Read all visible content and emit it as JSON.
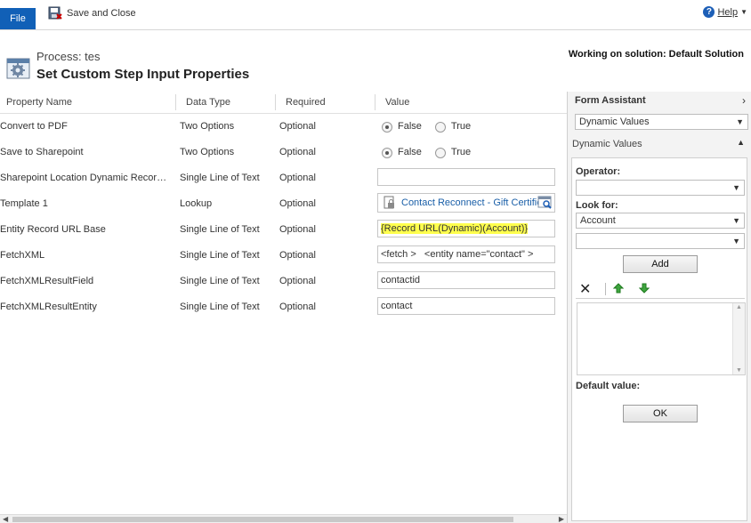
{
  "toolbar": {
    "file_label": "File",
    "save_close_label": "Save and Close",
    "help_label": "Help",
    "help_icon": "?"
  },
  "header": {
    "process": "Process: tes",
    "title": "Set Custom Step Input Properties",
    "solution": "Working on solution: Default Solution"
  },
  "grid": {
    "columns": [
      "Property Name",
      "Data Type",
      "Required",
      "Value"
    ],
    "rows": [
      {
        "name": "Convert to PDF",
        "type": "Two Options",
        "required": "Optional"
      },
      {
        "name": "Save to Sharepoint",
        "type": "Two Options",
        "required": "Optional"
      },
      {
        "name": "Sharepoint Location Dynamic Record ...",
        "type": "Single Line of Text",
        "required": "Optional",
        "value": ""
      },
      {
        "name": "Template 1",
        "type": "Lookup",
        "required": "Optional",
        "value": "Contact Reconnect - Gift Certific"
      },
      {
        "name": "Entity Record URL Base",
        "type": "Single Line of Text",
        "required": "Optional",
        "value": "{Record URL(Dynamic)(Account)}"
      },
      {
        "name": "FetchXML",
        "type": "Single Line of Text",
        "required": "Optional",
        "value": "<fetch >   <entity name=\"contact\" >"
      },
      {
        "name": "FetchXMLResultField",
        "type": "Single Line of Text",
        "required": "Optional",
        "value": "contactid"
      },
      {
        "name": "FetchXMLResultEntity",
        "type": "Single Line of Text",
        "required": "Optional",
        "value": "contact"
      }
    ],
    "options": {
      "false_label": "False",
      "true_label": "True"
    }
  },
  "form_assistant": {
    "title": "Form Assistant",
    "mode_select": "Dynamic Values",
    "section_label": "Dynamic Values",
    "operator_label": "Operator:",
    "operator_value": "",
    "look_for_label": "Look for:",
    "look_for_value": "Account",
    "look_for_sub_value": "",
    "add_label": "Add",
    "default_value_label": "Default value:",
    "ok_label": "OK"
  },
  "colors": {
    "accent": "#1160b7",
    "highlight": "#ffff4d",
    "link": "#1a5fa8"
  }
}
